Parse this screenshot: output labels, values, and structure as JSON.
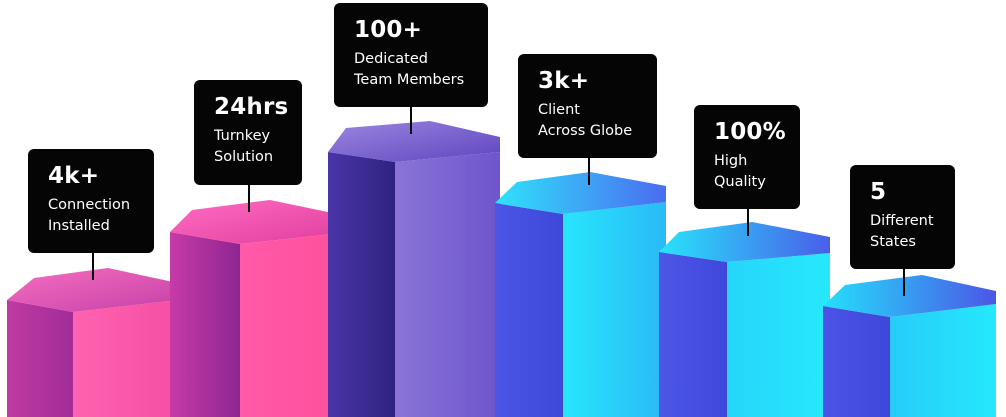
{
  "stats": [
    {
      "value": "4k+",
      "line1": "Connection",
      "line2": "Installed"
    },
    {
      "value": "24hrs",
      "line1": "Turnkey",
      "line2": "Solution"
    },
    {
      "value": "100+",
      "line1": "Dedicated",
      "line2": "Team Members"
    },
    {
      "value": "3k+",
      "line1": "Client",
      "line2": "Across Globe"
    },
    {
      "value": "100%",
      "line1": "High",
      "line2": "Quality"
    },
    {
      "value": "5",
      "line1": "Different",
      "line2": "States"
    }
  ],
  "colors": {
    "pink_light": "#ff5aa6",
    "pink_mid": "#d13ea8",
    "magenta_dark": "#a12c9a",
    "purple_light": "#8e6ad8",
    "purple_dark": "#3a2b8f",
    "blue": "#4b52e6",
    "cyan": "#22e4fb",
    "card_bg": "#050505"
  }
}
